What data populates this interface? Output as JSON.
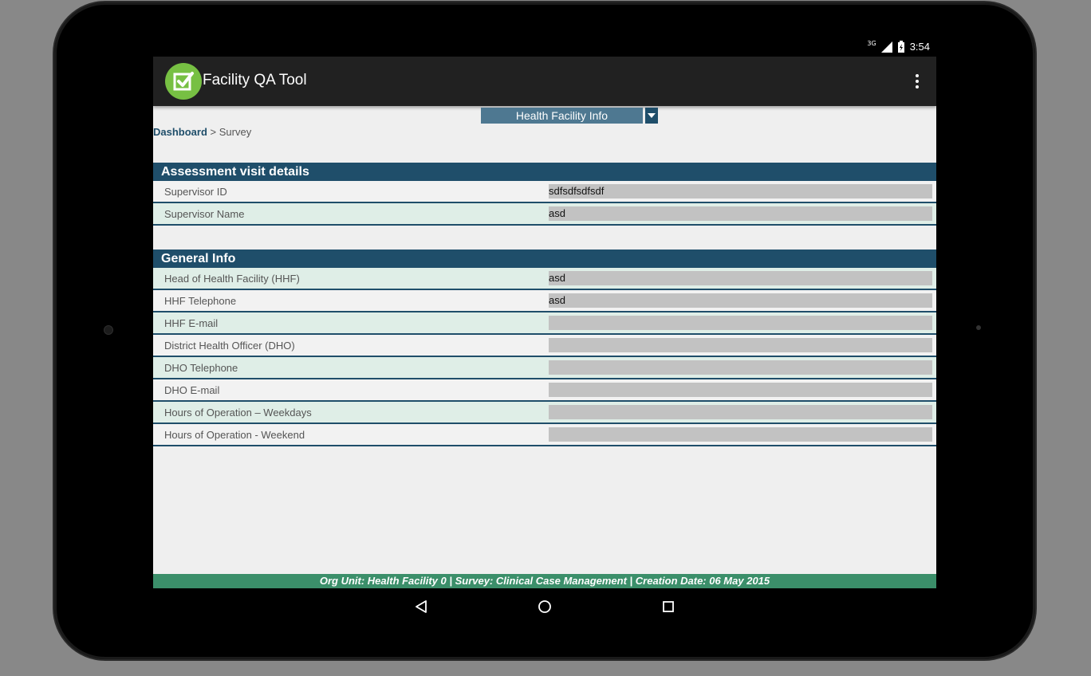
{
  "status_bar": {
    "network": "3G",
    "time": "3:54"
  },
  "app_bar": {
    "title": "Facility QA Tool",
    "logo_icon": "check-box-icon",
    "menu_icon": "overflow-menu-icon"
  },
  "section_selector": {
    "selected": "Health Facility Info"
  },
  "breadcrumb": {
    "root": "Dashboard",
    "separator": ">",
    "current": "Survey"
  },
  "sections": [
    {
      "title": "Assessment visit details",
      "rows": [
        {
          "label": "Supervisor ID",
          "value": "sdfsdfsdfsdf"
        },
        {
          "label": "Supervisor Name",
          "value": "asd"
        }
      ]
    },
    {
      "title": "General Info",
      "rows": [
        {
          "label": "Head of Health Facility (HHF)",
          "value": "asd"
        },
        {
          "label": "HHF Telephone",
          "value": "asd"
        },
        {
          "label": "HHF E-mail",
          "value": ""
        },
        {
          "label": "District Health Officer (DHO)",
          "value": ""
        },
        {
          "label": "DHO Telephone",
          "value": ""
        },
        {
          "label": "DHO E-mail",
          "value": ""
        },
        {
          "label": "Hours of Operation – Weekdays",
          "value": ""
        },
        {
          "label": "Hours of Operation - Weekend",
          "value": ""
        }
      ]
    }
  ],
  "footer": {
    "text": "Org Unit: Health Facility 0 | Survey: Clinical Case Management | Creation Date: 06 May 2015"
  },
  "colors": {
    "header_blue": "#1f4e6a",
    "selector_blue": "#4e7891",
    "footer_green": "#3b8f6a",
    "row_even": "#dfeee7",
    "row_odd": "#f2f2f2",
    "input_grey": "#c2c2c2",
    "logo_green": "#77c043"
  }
}
